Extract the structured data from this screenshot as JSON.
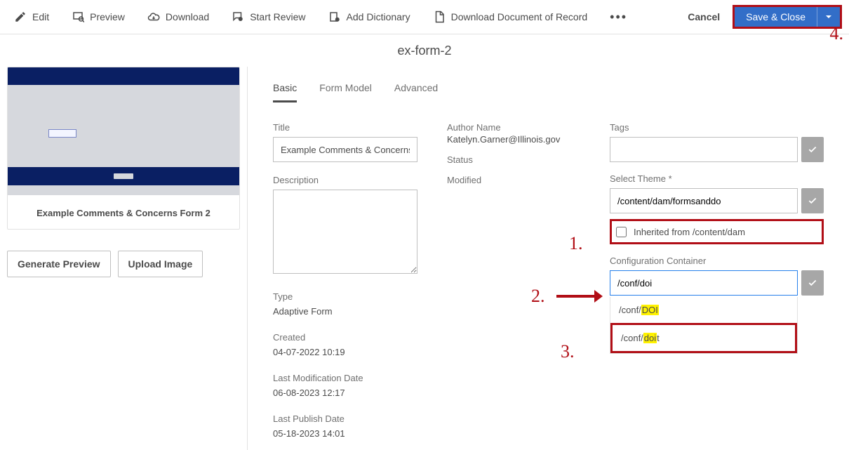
{
  "toolbar": {
    "items": [
      {
        "label": "Edit"
      },
      {
        "label": "Preview"
      },
      {
        "label": "Download"
      },
      {
        "label": "Start Review"
      },
      {
        "label": "Add Dictionary"
      },
      {
        "label": "Download Document of Record"
      }
    ],
    "cancel_label": "Cancel",
    "save_label": "Save & Close"
  },
  "page_title": "ex-form-2",
  "left": {
    "thumbnail_title": "Example Comments & Concerns Form 2",
    "generate_preview_label": "Generate Preview",
    "upload_image_label": "Upload Image"
  },
  "tabs": [
    {
      "label": "Basic"
    },
    {
      "label": "Form Model"
    },
    {
      "label": "Advanced"
    }
  ],
  "col_a": {
    "title_label": "Title",
    "title_value": "Example Comments & Concerns F",
    "description_label": "Description",
    "description_value": "",
    "type_label": "Type",
    "type_value": "Adaptive Form",
    "created_label": "Created",
    "created_value": "04-07-2022 10:19",
    "last_mod_label": "Last Modification Date",
    "last_mod_value": "06-08-2023 12:17",
    "last_pub_label": "Last Publish Date",
    "last_pub_value": "05-18-2023 14:01"
  },
  "col_b": {
    "author_label": "Author Name",
    "author_value": "Katelyn.Garner@Illinois.gov",
    "status_label": "Status",
    "status_value": "",
    "modified_label": "Modified",
    "modified_value": ""
  },
  "col_c": {
    "tags_label": "Tags",
    "tags_value": "",
    "theme_label": "Select Theme *",
    "theme_value": "/content/dam/formsanddo",
    "inherited_label": "Inherited from /content/dam",
    "cc_label": "Configuration Container",
    "cc_value": "/conf/doi",
    "cc_options": [
      {
        "prefix": "/conf/",
        "match": "DOI",
        "suffix": ""
      },
      {
        "prefix": "/conf/",
        "match": "doi",
        "suffix": "t"
      }
    ]
  },
  "annotations": {
    "a1": "1.",
    "a2": "2.",
    "a3": "3.",
    "a4": "4."
  }
}
